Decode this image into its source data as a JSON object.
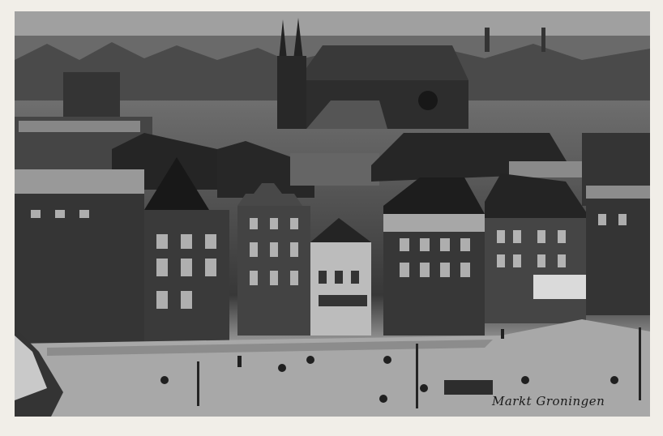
{
  "caption": "Markt Groningen",
  "colors": {
    "card": "#f1eee8",
    "sky_haze": "#8e8a84",
    "roofs_dark": "#2e2b28",
    "facade_brick": "#3b3834",
    "facade_light": "#bdb9b2",
    "square_pavement": "#aaa69f"
  }
}
